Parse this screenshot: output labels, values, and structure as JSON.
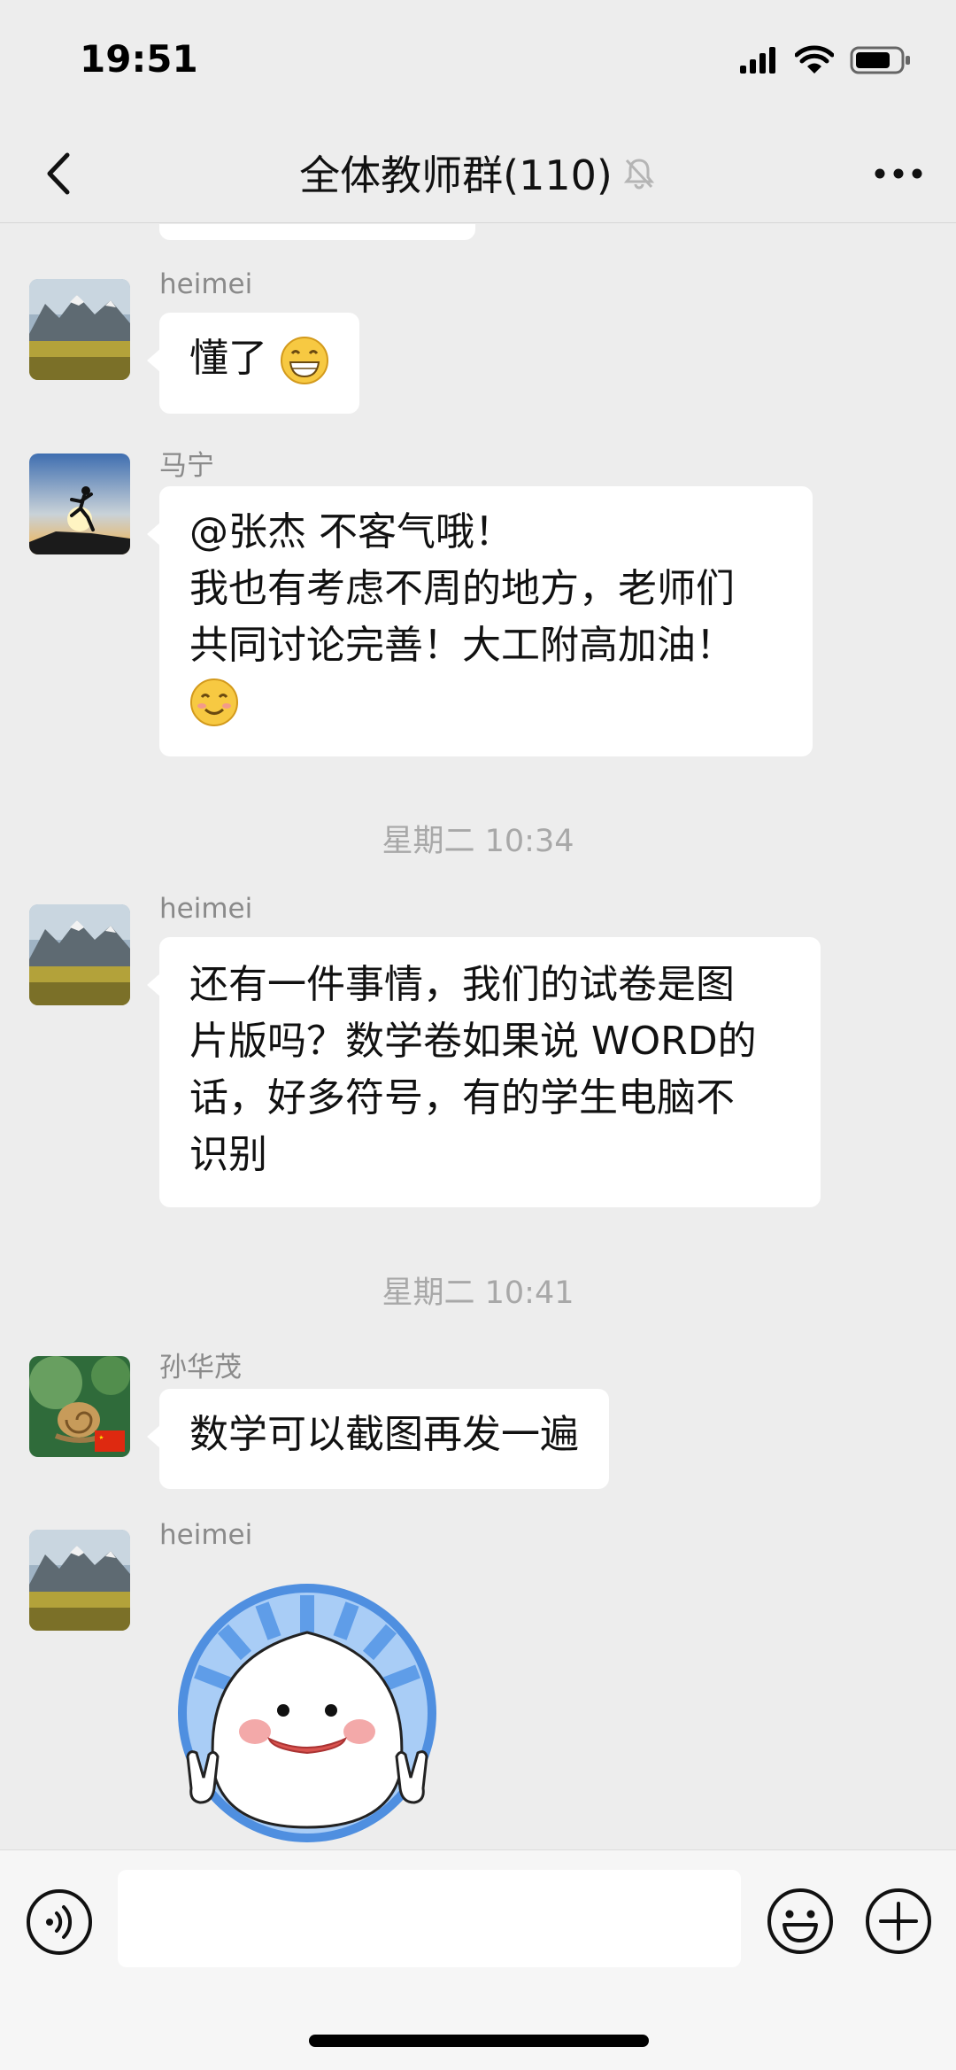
{
  "status_bar": {
    "time": "19:51",
    "icons": [
      "signal-icon",
      "wifi-icon",
      "battery-icon"
    ]
  },
  "nav": {
    "title": "全体教师群(110)",
    "icons": [
      "back-icon",
      "mute-bell-icon",
      "more-icon"
    ]
  },
  "messages": [
    {
      "sender": "heimei",
      "avatar": "mountain-landscape",
      "text_lines": [
        "懂了"
      ],
      "emoji": "grin-emoji"
    },
    {
      "sender": "马宁",
      "avatar": "sunset-runner",
      "text_lines": [
        "@张杰 不客气哦！",
        "我也有考虑不周的地方，老师们",
        "共同讨论完善！大工附高加油！"
      ],
      "emoji": "smile-emoji"
    },
    {
      "timestamp": "星期二 10:34"
    },
    {
      "sender": "heimei",
      "avatar": "mountain-landscape",
      "text_lines": [
        "还有一件事情，我们的试卷是图",
        "片版吗？数学卷如果说 WORD的",
        "话，好多符号，有的学生电脑不",
        "识别"
      ]
    },
    {
      "timestamp": "星期二 10:41"
    },
    {
      "sender": "孙华茂",
      "avatar": "snail-flag",
      "text_lines": [
        "数学可以截图再发一遍"
      ]
    },
    {
      "sender": "heimei",
      "avatar": "mountain-landscape",
      "sticker": "peace-sign-blob-sticker"
    }
  ],
  "input_bar": {
    "text": "",
    "icons": [
      "voice-icon",
      "emoji-icon",
      "plus-icon"
    ]
  },
  "colors": {
    "background": "#ededed",
    "bubble": "#ffffff",
    "meta_text": "#8a8a8a"
  }
}
